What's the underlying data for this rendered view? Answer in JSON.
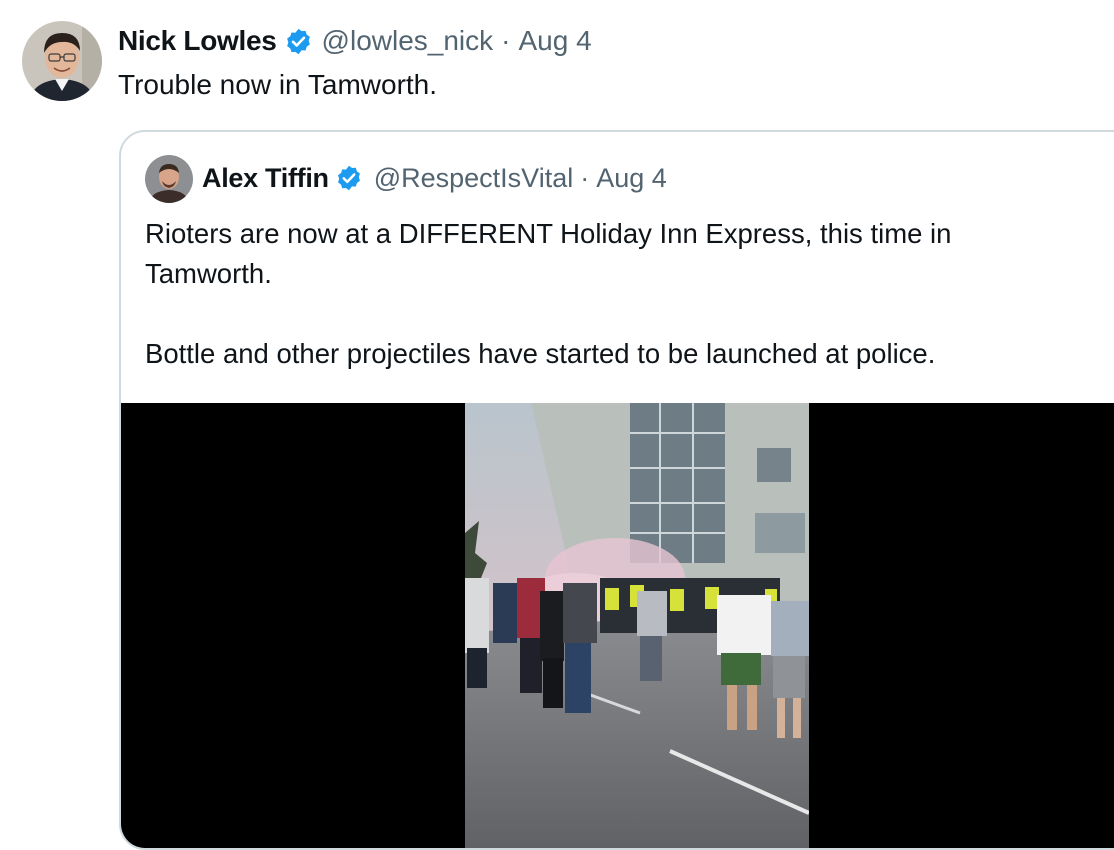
{
  "tweet": {
    "author": {
      "name": "Nick Lowles",
      "handle": "@lowles_nick"
    },
    "separator": "·",
    "date": "Aug 4",
    "text": "Trouble now in Tamworth."
  },
  "quoted_tweet": {
    "author": {
      "name": "Alex Tiffin",
      "handle": "@RespectIsVital"
    },
    "separator": "·",
    "date": "Aug 4",
    "text_lines": [
      "Rioters are now at a DIFFERENT Holiday Inn Express, this time in",
      "Tamworth.",
      "Bottle and other projectiles have started to be launched at police."
    ],
    "media": {
      "icon": "video-thumbnail"
    }
  },
  "colors": {
    "verified_badge": "#1d9bf0",
    "secondary_text": "#536471",
    "card_border": "#cfd9de"
  }
}
